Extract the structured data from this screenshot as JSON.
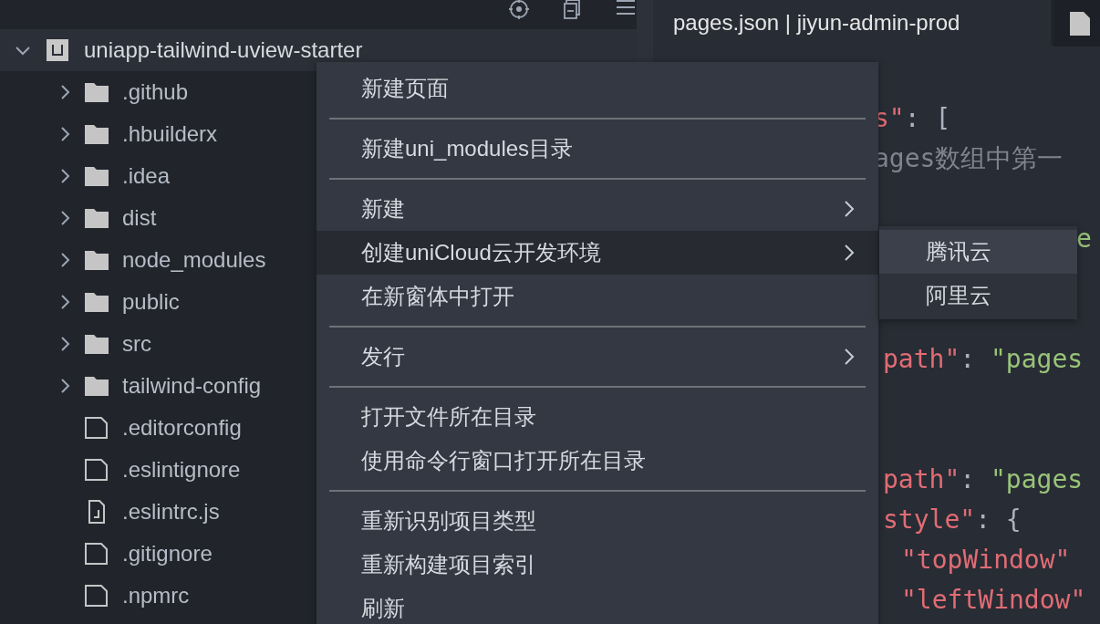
{
  "project": {
    "name": "uniapp-tailwind-uview-starter",
    "expanded": true,
    "selected": true
  },
  "tree": [
    {
      "name": ".github",
      "kind": "folder",
      "expanded": false
    },
    {
      "name": ".hbuilderx",
      "kind": "folder",
      "expanded": false
    },
    {
      "name": ".idea",
      "kind": "folder",
      "expanded": false
    },
    {
      "name": "dist",
      "kind": "folder",
      "expanded": false
    },
    {
      "name": "node_modules",
      "kind": "folder",
      "expanded": false
    },
    {
      "name": "public",
      "kind": "folder",
      "expanded": false
    },
    {
      "name": "src",
      "kind": "folder",
      "expanded": false
    },
    {
      "name": "tailwind-config",
      "kind": "folder",
      "expanded": false
    },
    {
      "name": ".editorconfig",
      "kind": "file"
    },
    {
      "name": ".eslintignore",
      "kind": "file"
    },
    {
      "name": ".eslintrc.js",
      "kind": "js"
    },
    {
      "name": ".gitignore",
      "kind": "file"
    },
    {
      "name": ".npmrc",
      "kind": "file"
    }
  ],
  "tabs": [
    {
      "label": "pages.json | jiyun-admin-prod",
      "selected": true
    },
    {
      "selected": false
    }
  ],
  "code_lines": [
    {
      "tokens": [
        {
          "text": "s\"",
          "kind": "key"
        },
        {
          "text": ": [",
          "kind": "punct"
        }
      ]
    },
    {
      "tokens": [
        {
          "text": "ages数组中第一",
          "kind": "comment"
        }
      ]
    },
    {
      "tokens": [
        {
          "text": "e",
          "kind": "string"
        }
      ]
    },
    {
      "tokens": [
        {
          "text": "path\"",
          "kind": "key"
        },
        {
          "text": ": ",
          "kind": "punct"
        },
        {
          "text": "\"pages",
          "kind": "string"
        }
      ]
    },
    {
      "tokens": [
        {
          "text": "path\"",
          "kind": "key"
        },
        {
          "text": ": ",
          "kind": "punct"
        },
        {
          "text": "\"pages",
          "kind": "string"
        }
      ]
    },
    {
      "tokens": [
        {
          "text": "style\"",
          "kind": "key"
        },
        {
          "text": ": {",
          "kind": "punct"
        }
      ]
    },
    {
      "tokens": [
        {
          "text": "\"topWindow\"",
          "kind": "key"
        }
      ]
    },
    {
      "tokens": [
        {
          "text": "\"leftWindow\"",
          "kind": "key"
        }
      ]
    }
  ],
  "context_menu": {
    "items": [
      {
        "kind": "item",
        "label": "新建页面",
        "submenu": false,
        "selected": false
      },
      {
        "kind": "separator"
      },
      {
        "kind": "item",
        "label": "新建uni_modules目录",
        "submenu": false,
        "selected": false
      },
      {
        "kind": "separator"
      },
      {
        "kind": "item",
        "label": "新建",
        "submenu": true,
        "selected": false
      },
      {
        "kind": "item",
        "label": "创建uniCloud云开发环境",
        "submenu": true,
        "selected": true
      },
      {
        "kind": "item",
        "label": "在新窗体中打开",
        "submenu": false,
        "selected": false
      },
      {
        "kind": "separator"
      },
      {
        "kind": "item",
        "label": "发行",
        "submenu": true,
        "selected": false
      },
      {
        "kind": "separator"
      },
      {
        "kind": "item",
        "label": "打开文件所在目录",
        "submenu": false,
        "selected": false
      },
      {
        "kind": "item",
        "label": "使用命令行窗口打开所在目录",
        "submenu": false,
        "selected": false
      },
      {
        "kind": "separator"
      },
      {
        "kind": "item",
        "label": "重新识别项目类型",
        "submenu": false,
        "selected": false
      },
      {
        "kind": "item",
        "label": "重新构建项目索引",
        "submenu": false,
        "selected": false
      },
      {
        "kind": "item",
        "label": "刷新",
        "submenu": false,
        "selected": false
      }
    ]
  },
  "submenu": {
    "items": [
      {
        "label": "腾讯云",
        "selected": true
      },
      {
        "label": "阿里云",
        "selected": false
      }
    ]
  }
}
